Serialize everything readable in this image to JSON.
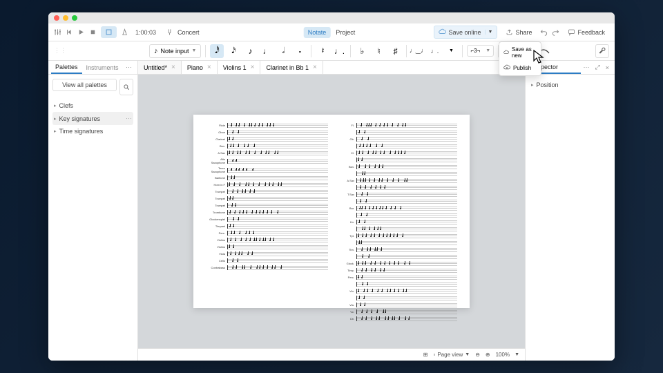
{
  "toolbar": {
    "time": "1:00:03",
    "concert": "Concert",
    "notate": "Notate",
    "project": "Project",
    "save": "Save online",
    "share": "Share",
    "feedback": "Feedback"
  },
  "notebar": {
    "input": "Note input",
    "voice": "1"
  },
  "dropdown": {
    "saveas": "Save as new",
    "publish": "Publish"
  },
  "palettes": {
    "tab1": "Palettes",
    "tab2": "Instruments",
    "viewall": "View all palettes",
    "items": [
      "Clefs",
      "Key signatures",
      "Time signatures"
    ]
  },
  "inspector": {
    "title": "Inspector",
    "position": "Position"
  },
  "tabs": [
    {
      "label": "Untitled*"
    },
    {
      "label": "Piano"
    },
    {
      "label": "Violins 1"
    },
    {
      "label": "Clarinet in Bb 1"
    }
  ],
  "instruments": [
    "Flute",
    "Oboe",
    "Clarinet",
    "Bsn.",
    "A.Sax",
    "Alto Saxophone",
    "Tenor Saxophone",
    "Baritone",
    "Horn in F",
    "Trumpet",
    "Trumpet",
    "Trumpet",
    "Trombone",
    "Glockenspiel",
    "Timpani",
    "Perc.",
    "Violins",
    "Violins",
    "Viola",
    "Cello",
    "Contrabass"
  ],
  "instruments2": [
    "Fl.",
    "",
    "Ob.",
    "",
    "Cl.",
    "",
    "Bsn.",
    "",
    "A.Sax",
    "",
    "T.Sax",
    "",
    "Bar.",
    "",
    "Hn.",
    "",
    "Tpt.",
    "",
    "Tbn.",
    "",
    "Glock.",
    "Timp.",
    "Perc.",
    "",
    "Vln.",
    "",
    "Vla.",
    "Vc.",
    "Cb."
  ],
  "status": {
    "view": "Page view",
    "zoom": "100%"
  }
}
